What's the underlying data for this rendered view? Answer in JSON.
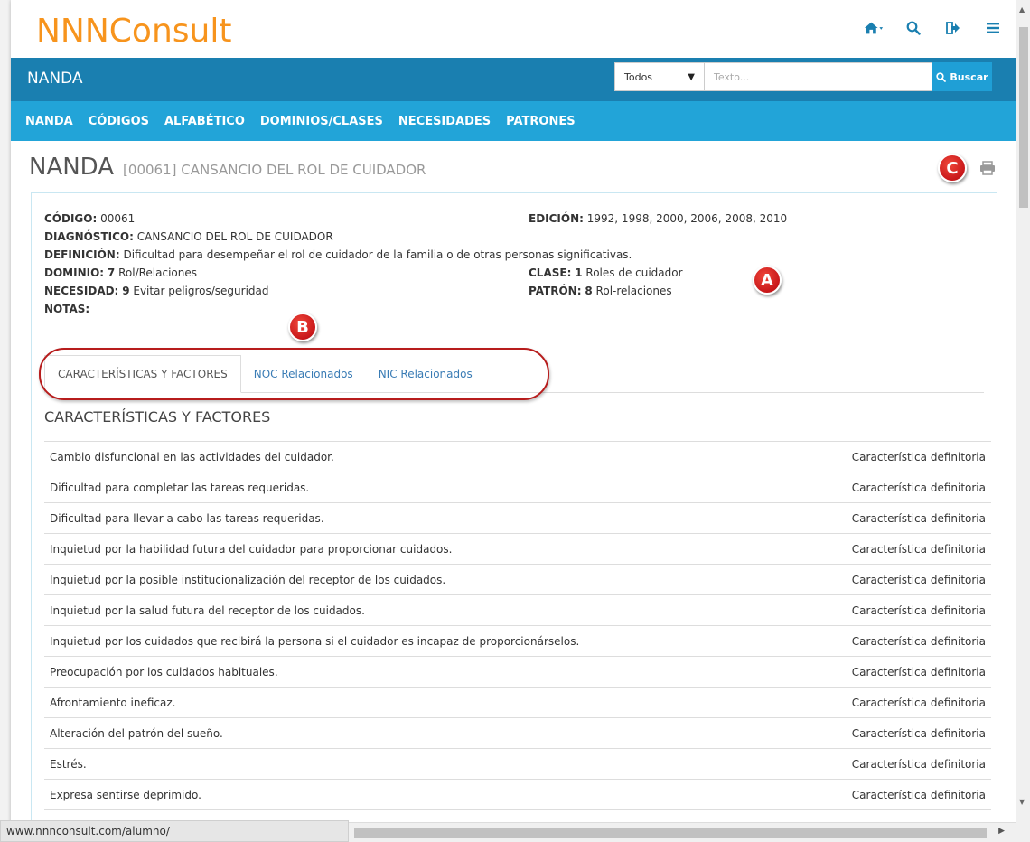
{
  "brand": {
    "logo": "NNNConsult"
  },
  "top_icons": [
    "home-icon",
    "search-icon",
    "logout-icon",
    "menu-icon"
  ],
  "title_bar": {
    "title": "NANDA"
  },
  "search": {
    "select_value": "Todos",
    "placeholder": "Texto...",
    "button_label": "Buscar"
  },
  "nav": {
    "items": [
      "NANDA",
      "CÓDIGOS",
      "ALFABÉTICO",
      "DOMINIOS/CLASES",
      "NECESIDADES",
      "PATRONES"
    ]
  },
  "heading": {
    "main": "NANDA",
    "sub": "[00061] CANSANCIO DEL ROL DE CUIDADOR"
  },
  "markers": {
    "a": "A",
    "b": "B",
    "c": "C"
  },
  "info": {
    "codigo_label": "CÓDIGO:",
    "codigo_value": "00061",
    "diagnostico_label": "DIAGNÓSTICO:",
    "diagnostico_value": "CANSANCIO DEL ROL DE CUIDADOR",
    "definicion_label": "DEFINICIÓN:",
    "definicion_value": "Dificultad para desempeñar el rol de cuidador de la familia o de otras personas significativas.",
    "dominio_label": "DOMINIO:",
    "dominio_num": "7",
    "dominio_value": "Rol/Relaciones",
    "necesidad_label": "NECESIDAD:",
    "necesidad_num": "9",
    "necesidad_value": "Evitar peligros/seguridad",
    "notas_label": "NOTAS:",
    "edicion_label": "EDICIÓN:",
    "edicion_value": "1992, 1998, 2000, 2006, 2008, 2010",
    "clase_label": "CLASE:",
    "clase_num": "1",
    "clase_value": "Roles de cuidador",
    "patron_label": "PATRÓN:",
    "patron_num": "8",
    "patron_value": "Rol-relaciones"
  },
  "tabs": [
    "CARACTERÍSTICAS Y FACTORES",
    "NOC Relacionados",
    "NIC Relacionados"
  ],
  "section_title": "CARACTERÍSTICAS Y FACTORES",
  "rows": [
    {
      "text": "Cambio disfuncional en las actividades del cuidador.",
      "type": "Característica definitoria"
    },
    {
      "text": "Dificultad para completar las tareas requeridas.",
      "type": "Característica definitoria"
    },
    {
      "text": "Dificultad para llevar a cabo las tareas requeridas.",
      "type": "Característica definitoria"
    },
    {
      "text": "Inquietud por la habilidad futura del cuidador para proporcionar cuidados.",
      "type": "Característica definitoria"
    },
    {
      "text": "Inquietud por la posible institucionalización del receptor de los cuidados.",
      "type": "Característica definitoria"
    },
    {
      "text": "Inquietud por la salud futura del receptor de los cuidados.",
      "type": "Característica definitoria"
    },
    {
      "text": "Inquietud por los cuidados que recibirá la persona si el cuidador es incapaz de proporcionárselos.",
      "type": "Característica definitoria"
    },
    {
      "text": "Preocupación por los cuidados habituales.",
      "type": "Característica definitoria"
    },
    {
      "text": "Afrontamiento ineficaz.",
      "type": "Característica definitoria"
    },
    {
      "text": "Alteración del patrón del sueño.",
      "type": "Característica definitoria"
    },
    {
      "text": "Estrés.",
      "type": "Característica definitoria"
    },
    {
      "text": "Expresa sentirse deprimido.",
      "type": "Característica definitoria"
    }
  ],
  "status_bar": {
    "url": "www.nnnconsult.com/alumno/"
  },
  "colors": {
    "brand_orange": "#f7941d",
    "title_blue": "#1a7fb0",
    "nav_blue": "#22a4d8",
    "marker_red": "#c8171a"
  }
}
